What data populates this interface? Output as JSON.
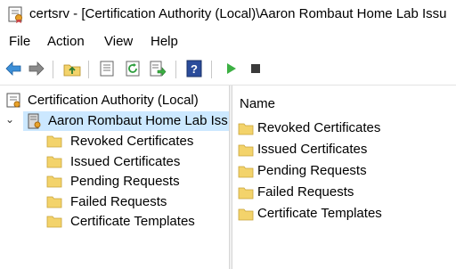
{
  "window": {
    "title": "certsrv - [Certification Authority (Local)\\Aaron Rombaut Home Lab Issu",
    "app_icon": "certsrv-icon"
  },
  "menu": {
    "items": [
      "File",
      "Action",
      "View",
      "Help"
    ]
  },
  "toolbar": {
    "buttons": [
      "back-arrow-icon",
      "forward-arrow-icon",
      "up-folder-icon",
      "properties-icon",
      "refresh-icon",
      "export-list-icon",
      "help-icon",
      "start-service-icon",
      "stop-service-icon"
    ]
  },
  "tree": {
    "root": "Certification Authority (Local)",
    "ca_node": "Aaron Rombaut Home Lab Iss",
    "children": [
      "Revoked Certificates",
      "Issued Certificates",
      "Pending Requests",
      "Failed Requests",
      "Certificate Templates"
    ]
  },
  "list": {
    "column_header": "Name",
    "items": [
      "Revoked Certificates",
      "Issued Certificates",
      "Pending Requests",
      "Failed Requests",
      "Certificate Templates"
    ]
  },
  "colors": {
    "selection": "#cce8ff",
    "folder": "#f3d36b",
    "folder_dark": "#dcb44a",
    "help_blue": "#2b4c9b",
    "play_green": "#3cb043"
  }
}
